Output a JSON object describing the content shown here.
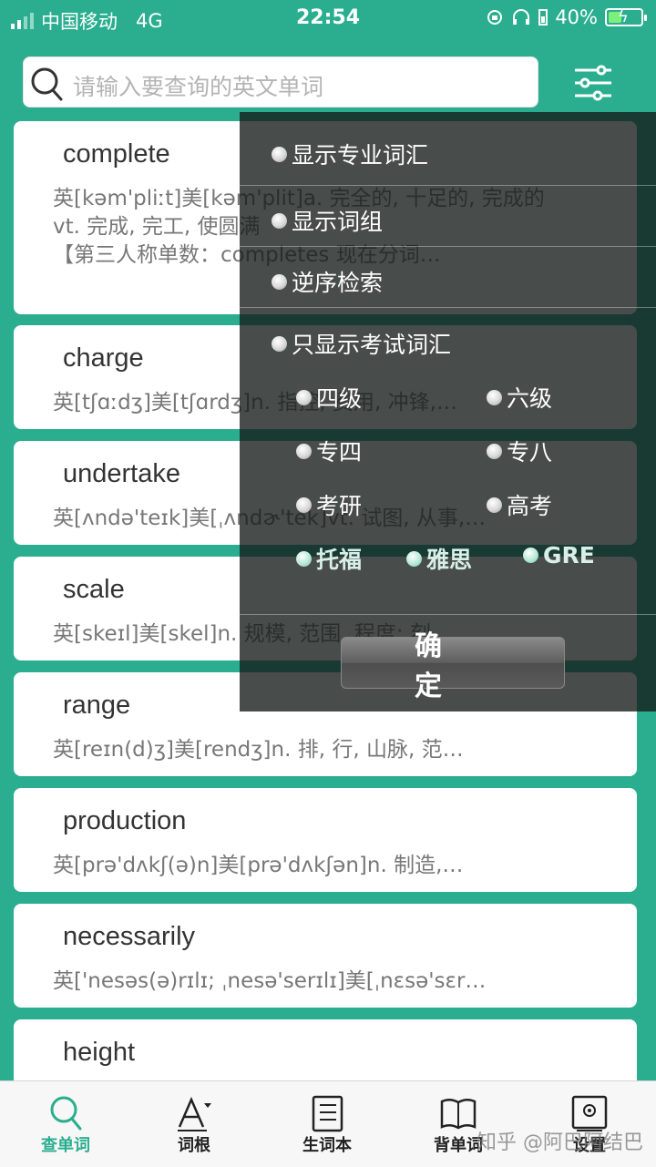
{
  "status_bar": {
    "carrier": "中国移动",
    "network": "4G",
    "time": "22:54",
    "battery": "40%",
    "battery_level": 0.4
  },
  "search": {
    "placeholder": "请输入要查询的英文单词",
    "icon": "search-icon",
    "filter_icon": "sliders-icon"
  },
  "words": [
    {
      "word": "complete",
      "definition": "英[kəm'pliːt]美[kəm'plit]a. 完全的, 十足的, 完成的\nvt. 完成, 完工, 使圆满\n【第三人称单数：completes 现在分词…"
    },
    {
      "word": "charge",
      "definition": "英[tʃɑːdʒ]美[tʃɑrdʒ]n. 指控, 费用, 冲锋,…"
    },
    {
      "word": "undertake",
      "definition": "英[ʌndə'teɪk]美[ˌʌndɚ'tek]vt. 试图, 从事,…"
    },
    {
      "word": "scale",
      "definition": "英[skeɪl]美[skel]n. 规模, 范围, 程度; 刻…"
    },
    {
      "word": "range",
      "definition": "英[reɪn(d)ʒ]美[rendʒ]n. 排, 行, 山脉, 范…"
    },
    {
      "word": "production",
      "definition": "英[prə'dʌkʃ(ə)n]美[prə'dʌkʃən]n. 制造,…"
    },
    {
      "word": "necessarily",
      "definition": "英['nesəs(ə)rɪlɪ; ˌnesə'serɪlɪ]美[ˌnɛsə'sɛr…"
    },
    {
      "word": "height",
      "definition": ""
    }
  ],
  "filter_panel": {
    "options": [
      "显示专业词汇",
      "显示词组",
      "逆序检索",
      "只显示考试词汇"
    ],
    "exams": [
      "四级",
      "六级",
      "专四",
      "专八",
      "考研",
      "高考",
      "托福",
      "雅思",
      "GRE"
    ],
    "confirm_label": "确定"
  },
  "bottom_nav": [
    {
      "label": "查单词",
      "icon": "search-icon",
      "active": true
    },
    {
      "label": "词根",
      "icon": "letter-a-icon",
      "active": false
    },
    {
      "label": "生词本",
      "icon": "notebook-icon",
      "active": false
    },
    {
      "label": "背单词",
      "icon": "book-open-icon",
      "active": false
    },
    {
      "label": "设置",
      "icon": "gear-icon",
      "active": false
    }
  ],
  "watermark": "知乎 @阿巴阿结巴",
  "colors": {
    "accent": "#2aae8f",
    "overlay": "#141a18"
  }
}
